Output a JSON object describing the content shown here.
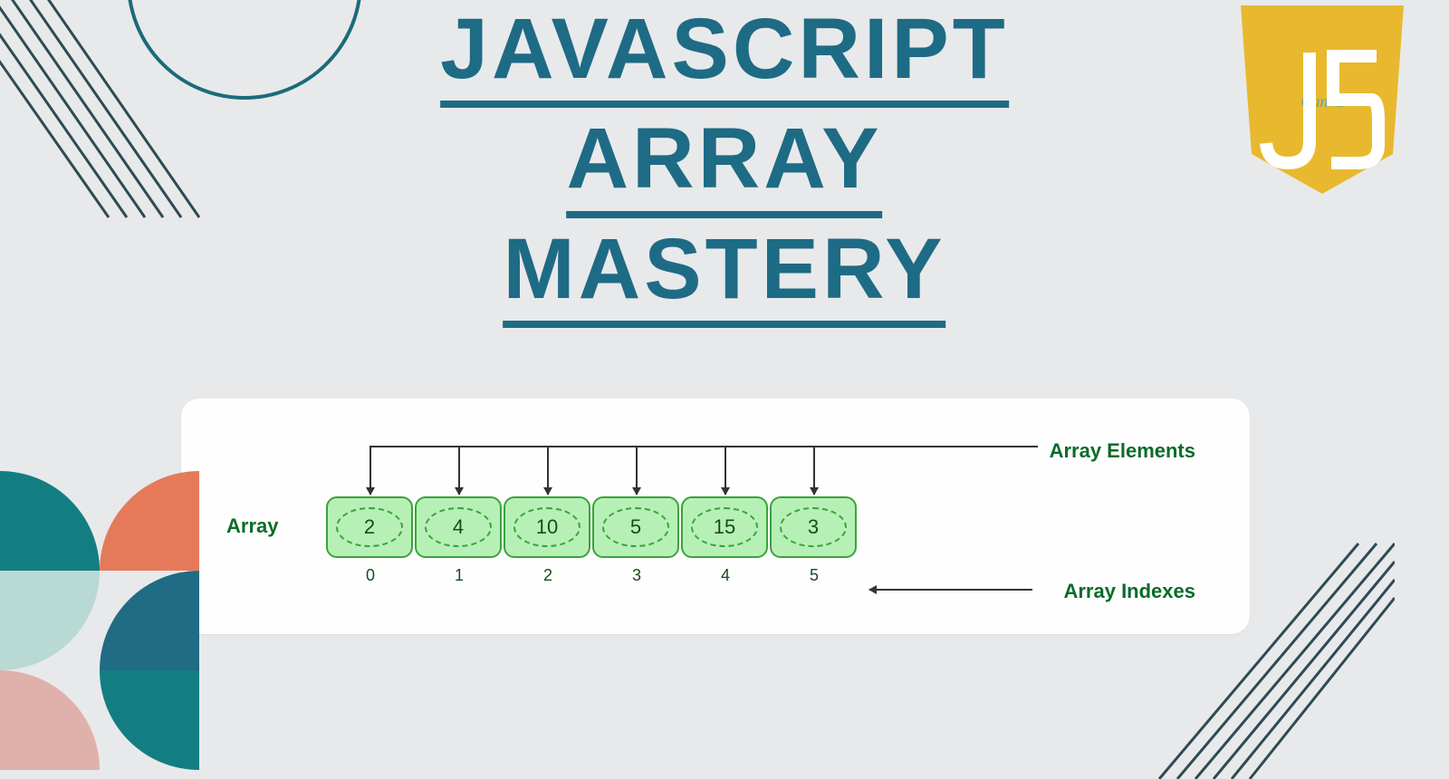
{
  "title": {
    "line1": "JAVASCRIPT",
    "line2": "ARRAY",
    "line3": "MASTERY"
  },
  "logo": {
    "text": "JS",
    "watermark": "Canva"
  },
  "diagram": {
    "label_array": "Array",
    "label_elements": "Array Elements",
    "label_indexes": "Array Indexes",
    "values": [
      "2",
      "4",
      "10",
      "5",
      "15",
      "3"
    ],
    "indexes": [
      "0",
      "1",
      "2",
      "3",
      "4",
      "5"
    ]
  },
  "colors": {
    "title": "#1e6b85",
    "cell_bg": "#b6f0b6",
    "cell_border": "#3aa33a",
    "label": "#0a6b2a",
    "shield": "#e8b92f"
  }
}
